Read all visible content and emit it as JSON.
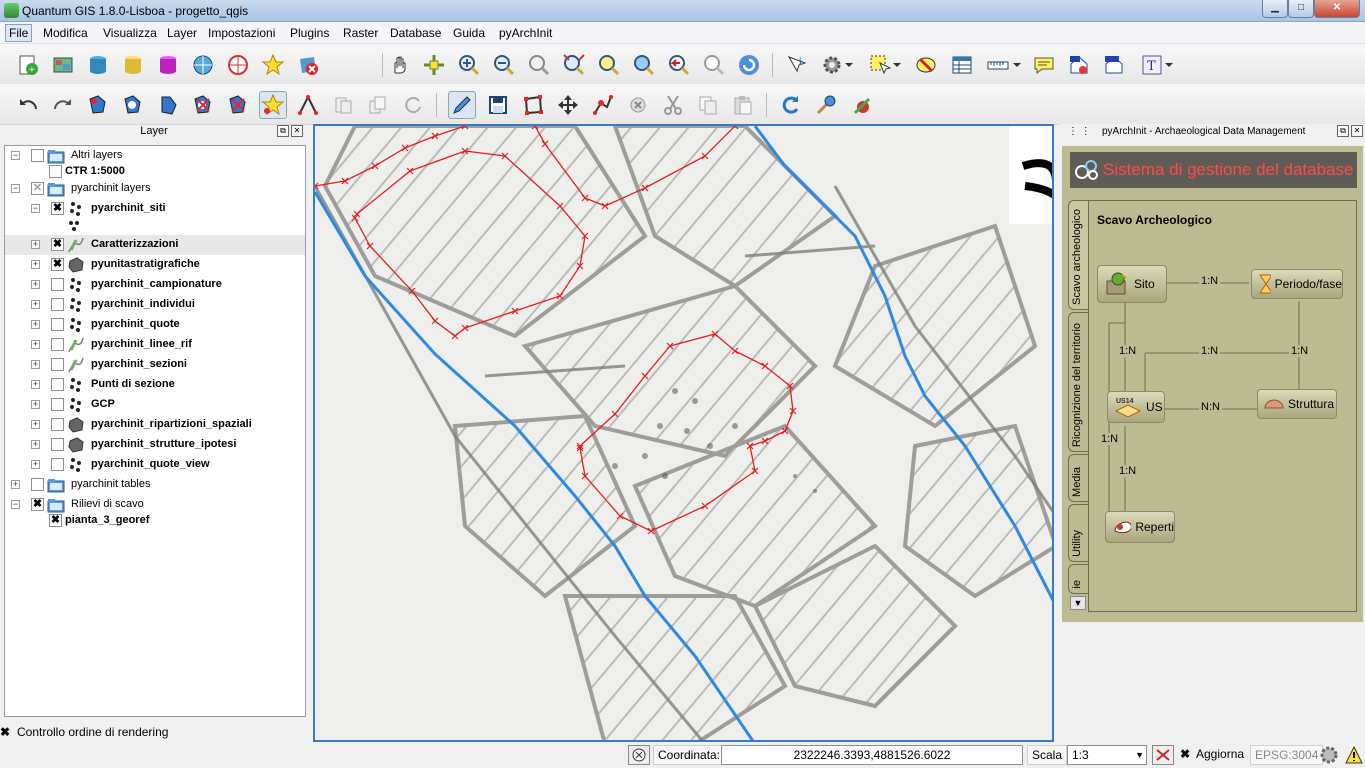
{
  "window": {
    "title": "Quantum GIS 1.8.0-Lisboa - progetto_qgis",
    "minimize": "▁",
    "maximize": "□",
    "close": "✕"
  },
  "menu": [
    "File",
    "Modifica",
    "Visualizza",
    "Layer",
    "Impostazioni",
    "Plugins",
    "Raster",
    "Database",
    "Guida",
    "pyArchInit"
  ],
  "layer_panel": {
    "title": "Layer",
    "items": [
      {
        "label": "Altri layers",
        "bold": false,
        "checked": "",
        "icon": "folder-icon"
      },
      {
        "label": "CTR 1:5000",
        "bold": true,
        "checked": "",
        "icon": ""
      },
      {
        "label": "pyarchinit layers",
        "bold": false,
        "checked": "✕",
        "icon": "folder-icon"
      },
      {
        "label": "pyarchinit_siti",
        "bold": true,
        "checked": "✖",
        "icon": "points-icon"
      },
      {
        "label": "Caratterizzazioni",
        "bold": true,
        "checked": "✖",
        "icon": "line-icon"
      },
      {
        "label": "pyunitastratigrafiche",
        "bold": true,
        "checked": "✖",
        "icon": "polygon-icon"
      },
      {
        "label": "pyarchinit_campionature",
        "bold": true,
        "checked": "",
        "icon": "points-icon"
      },
      {
        "label": "pyarchinit_individui",
        "bold": true,
        "checked": "",
        "icon": "points-icon"
      },
      {
        "label": "pyarchinit_quote",
        "bold": true,
        "checked": "",
        "icon": "points-icon"
      },
      {
        "label": "pyarchinit_linee_rif",
        "bold": true,
        "checked": "",
        "icon": "line-icon"
      },
      {
        "label": "pyarchinit_sezioni",
        "bold": true,
        "checked": "",
        "icon": "line-icon"
      },
      {
        "label": "Punti di sezione",
        "bold": true,
        "checked": "",
        "icon": "points-icon"
      },
      {
        "label": "GCP",
        "bold": true,
        "checked": "",
        "icon": "points-icon"
      },
      {
        "label": "pyarchinit_ripartizioni_spaziali",
        "bold": true,
        "checked": "",
        "icon": "polygon-icon"
      },
      {
        "label": "pyarchinit_strutture_ipotesi",
        "bold": true,
        "checked": "",
        "icon": "polygon-icon"
      },
      {
        "label": "pyarchinit_quote_view",
        "bold": true,
        "checked": "",
        "icon": "points-icon"
      },
      {
        "label": "pyarchinit tables",
        "bold": false,
        "checked": "",
        "icon": "folder-icon"
      },
      {
        "label": "Rilievi di scavo",
        "bold": false,
        "checked": "✖",
        "icon": "folder-icon"
      },
      {
        "label": "pianta_3_georef",
        "bold": true,
        "checked": "✖",
        "icon": ""
      }
    ],
    "render_order": {
      "label": "Controllo ordine di rendering",
      "checked": "✖"
    }
  },
  "pyarchinit": {
    "dock_title": "pyArchInit - Archaeological Data Management",
    "header": "Sistema di gestione del database",
    "tabs": [
      "Scavo archeologico",
      "Ricognizione del territorio",
      "Media",
      "Utility",
      "ie"
    ],
    "section_title": "Scavo Archeologico",
    "entities": {
      "sito": "Sito",
      "periodo": "Periodo/fase",
      "us": "US",
      "struttura": "Struttura",
      "reperti": "Reperti"
    },
    "relations": {
      "sito_periodo": "1:N",
      "sito_us": "1:N",
      "us_periodo": "1:N",
      "periodo_struttura": "1:N",
      "us_struttura": "N:N",
      "us_reperti": "1:N",
      "sito_reperti": "1:N"
    },
    "us_badge": "US14"
  },
  "statusbar": {
    "coord_label": "Coordinata:",
    "coord_value": "2322246.3393,4881526.6022",
    "scale_label": "Scala",
    "scale_value": "1:3",
    "refresh_label": "Aggiorna",
    "refresh_checked": "✖",
    "crs": "EPSG:3004"
  },
  "colors": {
    "map_border": "#3b78c6",
    "digitized_line": "#e02020",
    "blue_line": "#2d8ae0",
    "pyarchinit_bg": "#bdbb91"
  }
}
